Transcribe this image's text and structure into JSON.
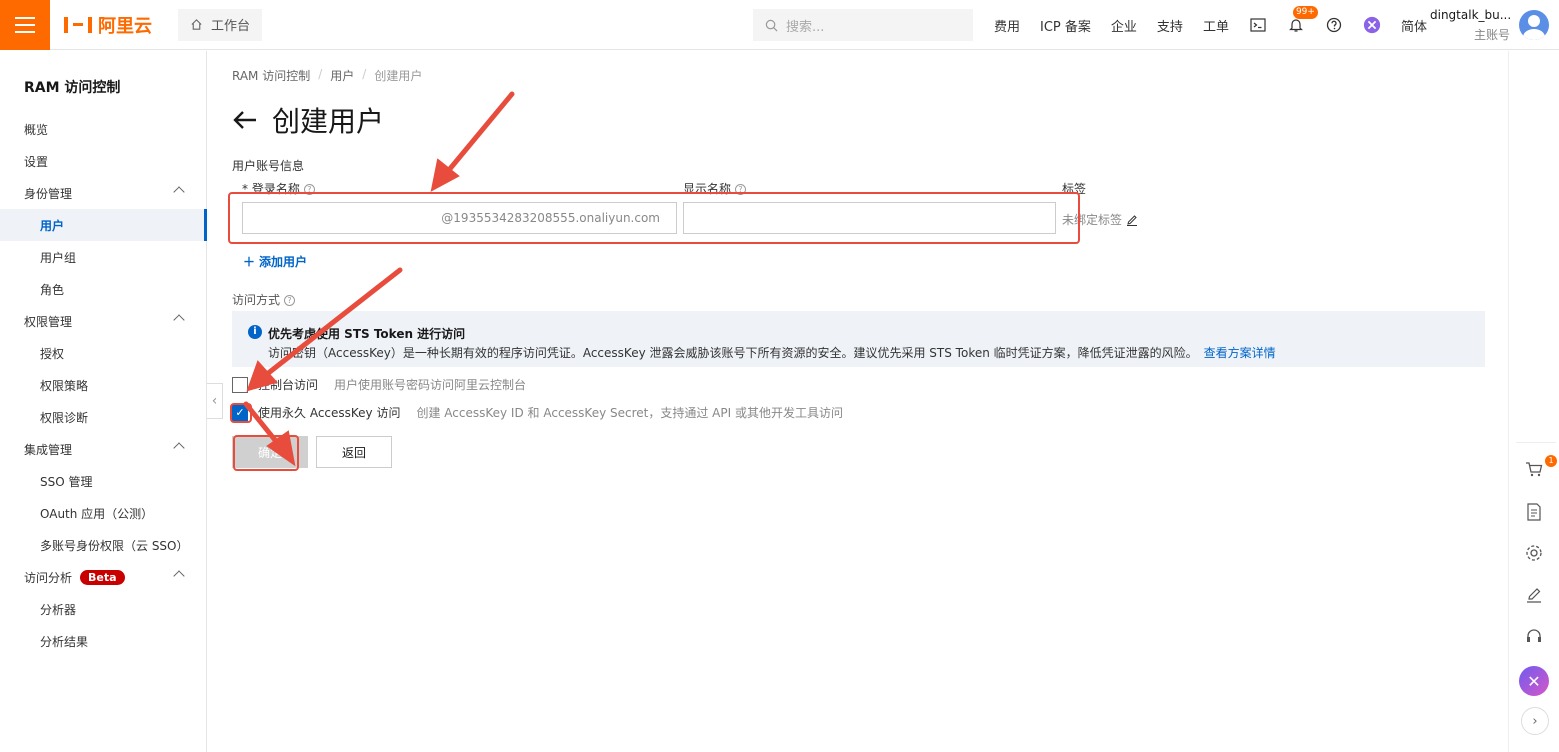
{
  "header": {
    "logo_text": "阿里云",
    "workbench_label": "工作台",
    "search_placeholder": "搜索...",
    "links": [
      "费用",
      "ICP 备案",
      "企业",
      "支持",
      "工单"
    ],
    "notify_badge": "99+",
    "lang": "简体",
    "user_name": "dingtalk_bu...",
    "user_role": "主账号"
  },
  "sidebar": {
    "title": "RAM 访问控制",
    "items": [
      {
        "label": "概览",
        "level": 1
      },
      {
        "label": "设置",
        "level": 1
      },
      {
        "label": "身份管理",
        "level": 1,
        "group": true
      },
      {
        "label": "用户",
        "level": 2,
        "active": true
      },
      {
        "label": "用户组",
        "level": 2
      },
      {
        "label": "角色",
        "level": 2
      },
      {
        "label": "权限管理",
        "level": 1,
        "group": true
      },
      {
        "label": "授权",
        "level": 2
      },
      {
        "label": "权限策略",
        "level": 2
      },
      {
        "label": "权限诊断",
        "level": 2
      },
      {
        "label": "集成管理",
        "level": 1,
        "group": true
      },
      {
        "label": "SSO 管理",
        "level": 2
      },
      {
        "label": "OAuth 应用（公测）",
        "level": 2
      },
      {
        "label": "多账号身份权限（云 SSO）",
        "level": 2
      },
      {
        "label": "访问分析",
        "level": 1,
        "group": true,
        "badge": "Beta"
      },
      {
        "label": "分析器",
        "level": 2
      },
      {
        "label": "分析结果",
        "level": 2
      }
    ]
  },
  "breadcrumb": [
    "RAM 访问控制",
    "用户",
    "创建用户"
  ],
  "page_title": "创建用户",
  "form": {
    "section": "用户账号信息",
    "login_name_label": "* 登录名称",
    "login_name_suffix": "@1935534283208555.onaliyun.com",
    "display_name_label": "显示名称",
    "tag_label": "标签",
    "tag_value": "未绑定标签",
    "add_user": "添加用户",
    "access_label": "访问方式",
    "alert_title": "优先考虑使用 STS Token 进行访问",
    "alert_body": "访问密钥（AccessKey）是一种长期有效的程序访问凭证。AccessKey 泄露会威胁该账号下所有资源的安全。建议优先采用 STS Token 临时凭证方案，降低凭证泄露的风险。",
    "alert_link": "查看方案详情",
    "options": [
      {
        "label": "控制台访问",
        "hint": "用户使用账号密码访问阿里云控制台",
        "checked": false
      },
      {
        "label": "使用永久 AccessKey 访问",
        "hint": "创建 AccessKey ID 和 AccessKey Secret，支持通过 API 或其他开发工具访问",
        "checked": true
      }
    ],
    "ok_label": "确定",
    "back_label": "返回"
  },
  "rail": {
    "cart_badge": "1"
  }
}
